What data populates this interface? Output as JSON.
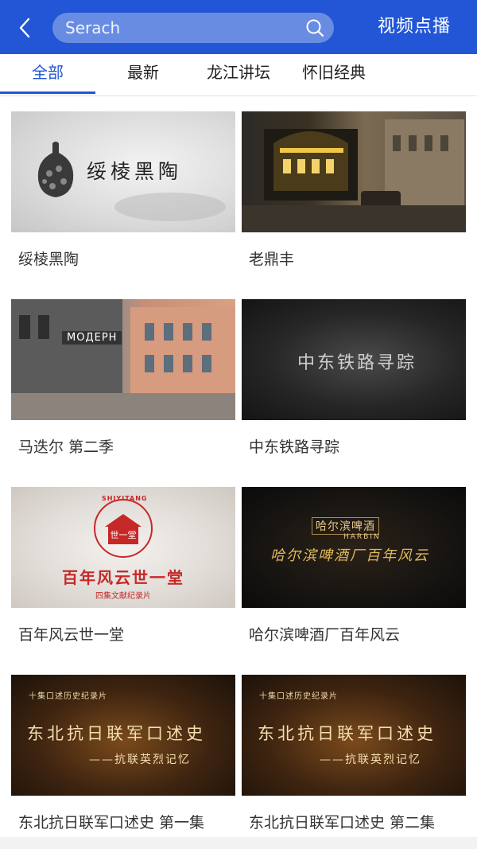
{
  "header": {
    "back_icon": "chevron-left-icon",
    "search_placeholder": "Serach",
    "search_icon": "search-icon",
    "title": "视频点播"
  },
  "tabs": [
    {
      "label": "全部",
      "active": true
    },
    {
      "label": "最新",
      "active": false
    },
    {
      "label": "龙江讲坛",
      "active": false
    },
    {
      "label": "怀旧经典",
      "active": false
    }
  ],
  "videos": [
    {
      "title": "绥棱黑陶",
      "thumb_text": "绥棱黑陶"
    },
    {
      "title": "老鼎丰",
      "thumb_text": ""
    },
    {
      "title": "马迭尔 第二季",
      "thumb_text": "МОДЕРН"
    },
    {
      "title": "中东铁路寻踪",
      "thumb_text": "中东铁路寻踪"
    },
    {
      "title": "百年风云世一堂",
      "thumb_text": "百年风云世一堂",
      "thumb_sub": "四集文献纪录片",
      "thumb_logo": "SHIYITANG",
      "thumb_seal": "世一堂"
    },
    {
      "title": "哈尔滨啤酒厂百年风云",
      "thumb_text": "哈尔滨啤酒厂百年风云",
      "thumb_logo": "哈尔滨啤酒",
      "thumb_sub": "HARBIN"
    },
    {
      "title": "东北抗日联军口述史 第一集",
      "thumb_text": "东北抗日联军口述史",
      "thumb_top": "十集口述历史纪录片",
      "thumb_sub": "——抗联英烈记忆"
    },
    {
      "title": "东北抗日联军口述史 第二集",
      "thumb_text": "东北抗日联军口述史",
      "thumb_top": "十集口述历史纪录片",
      "thumb_sub": "——抗联英烈记忆"
    }
  ],
  "colors": {
    "brand_blue": "#2256d6",
    "text": "#333333"
  }
}
